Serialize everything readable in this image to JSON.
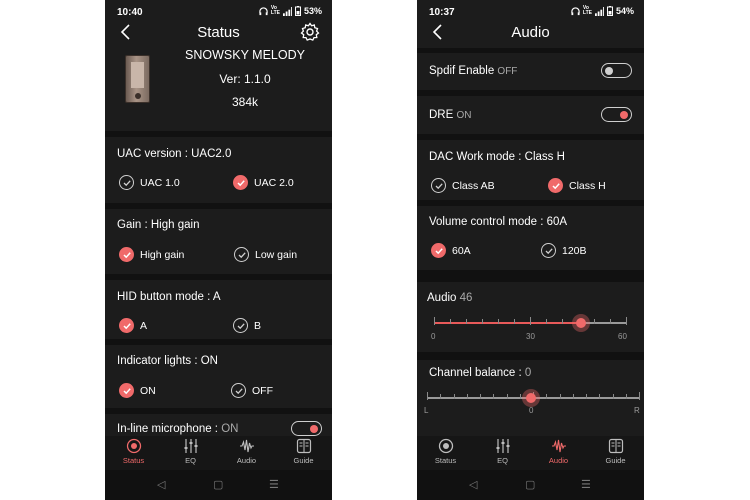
{
  "left": {
    "statusbar": {
      "time": "10:40",
      "battery": "53%"
    },
    "title": "Status",
    "device": {
      "name": "SNOWSKY MELODY",
      "version": "Ver: 1.1.0",
      "rate": "384k"
    },
    "uac": {
      "label": "UAC version : UAC2.0",
      "opt1": "UAC 1.0",
      "opt2": "UAC 2.0"
    },
    "gain": {
      "label": "Gain : High gain",
      "opt1": "High gain",
      "opt2": "Low gain"
    },
    "hid": {
      "label": "HID button mode : A",
      "opt1": "A",
      "opt2": "B"
    },
    "indicator": {
      "label": "Indicator lights : ON",
      "opt1": "ON",
      "opt2": "OFF"
    },
    "mic": {
      "label": "In-line microphone :",
      "state": "ON"
    }
  },
  "right": {
    "statusbar": {
      "time": "10:37",
      "battery": "54%"
    },
    "title": "Audio",
    "spdif": {
      "label": "Spdif Enable",
      "state": "OFF",
      "on": false
    },
    "dre": {
      "label": "DRE",
      "state": "ON",
      "on": true
    },
    "dac": {
      "label": "DAC Work mode : Class H",
      "opt1": "Class AB",
      "opt2": "Class H"
    },
    "volmode": {
      "label": "Volume control mode : 60A",
      "opt1": "60A",
      "opt2": "120B"
    },
    "audio": {
      "label": "Audio",
      "value": "46",
      "min": "0",
      "mid": "30",
      "max": "60",
      "level": 46,
      "range": [
        0,
        60
      ]
    },
    "balance": {
      "label": "Channel balance :",
      "value": "0",
      "left": "L",
      "center": "0",
      "right": "R"
    }
  },
  "tabs": {
    "status": "Status",
    "eq": "EQ",
    "audio": "Audio",
    "guide": "Guide"
  },
  "colors": {
    "accent": "#f06a6a",
    "background": "#1c1c1c",
    "separator": "#111111"
  },
  "icons": [
    "back-icon",
    "gear-icon",
    "check-icon",
    "status-icon",
    "eq-icon",
    "audio-wave-icon",
    "guide-icon",
    "nav-back-icon",
    "nav-home-icon",
    "nav-menu-icon",
    "headphones-icon",
    "wifi-icon",
    "signal-icon",
    "battery-icon"
  ]
}
